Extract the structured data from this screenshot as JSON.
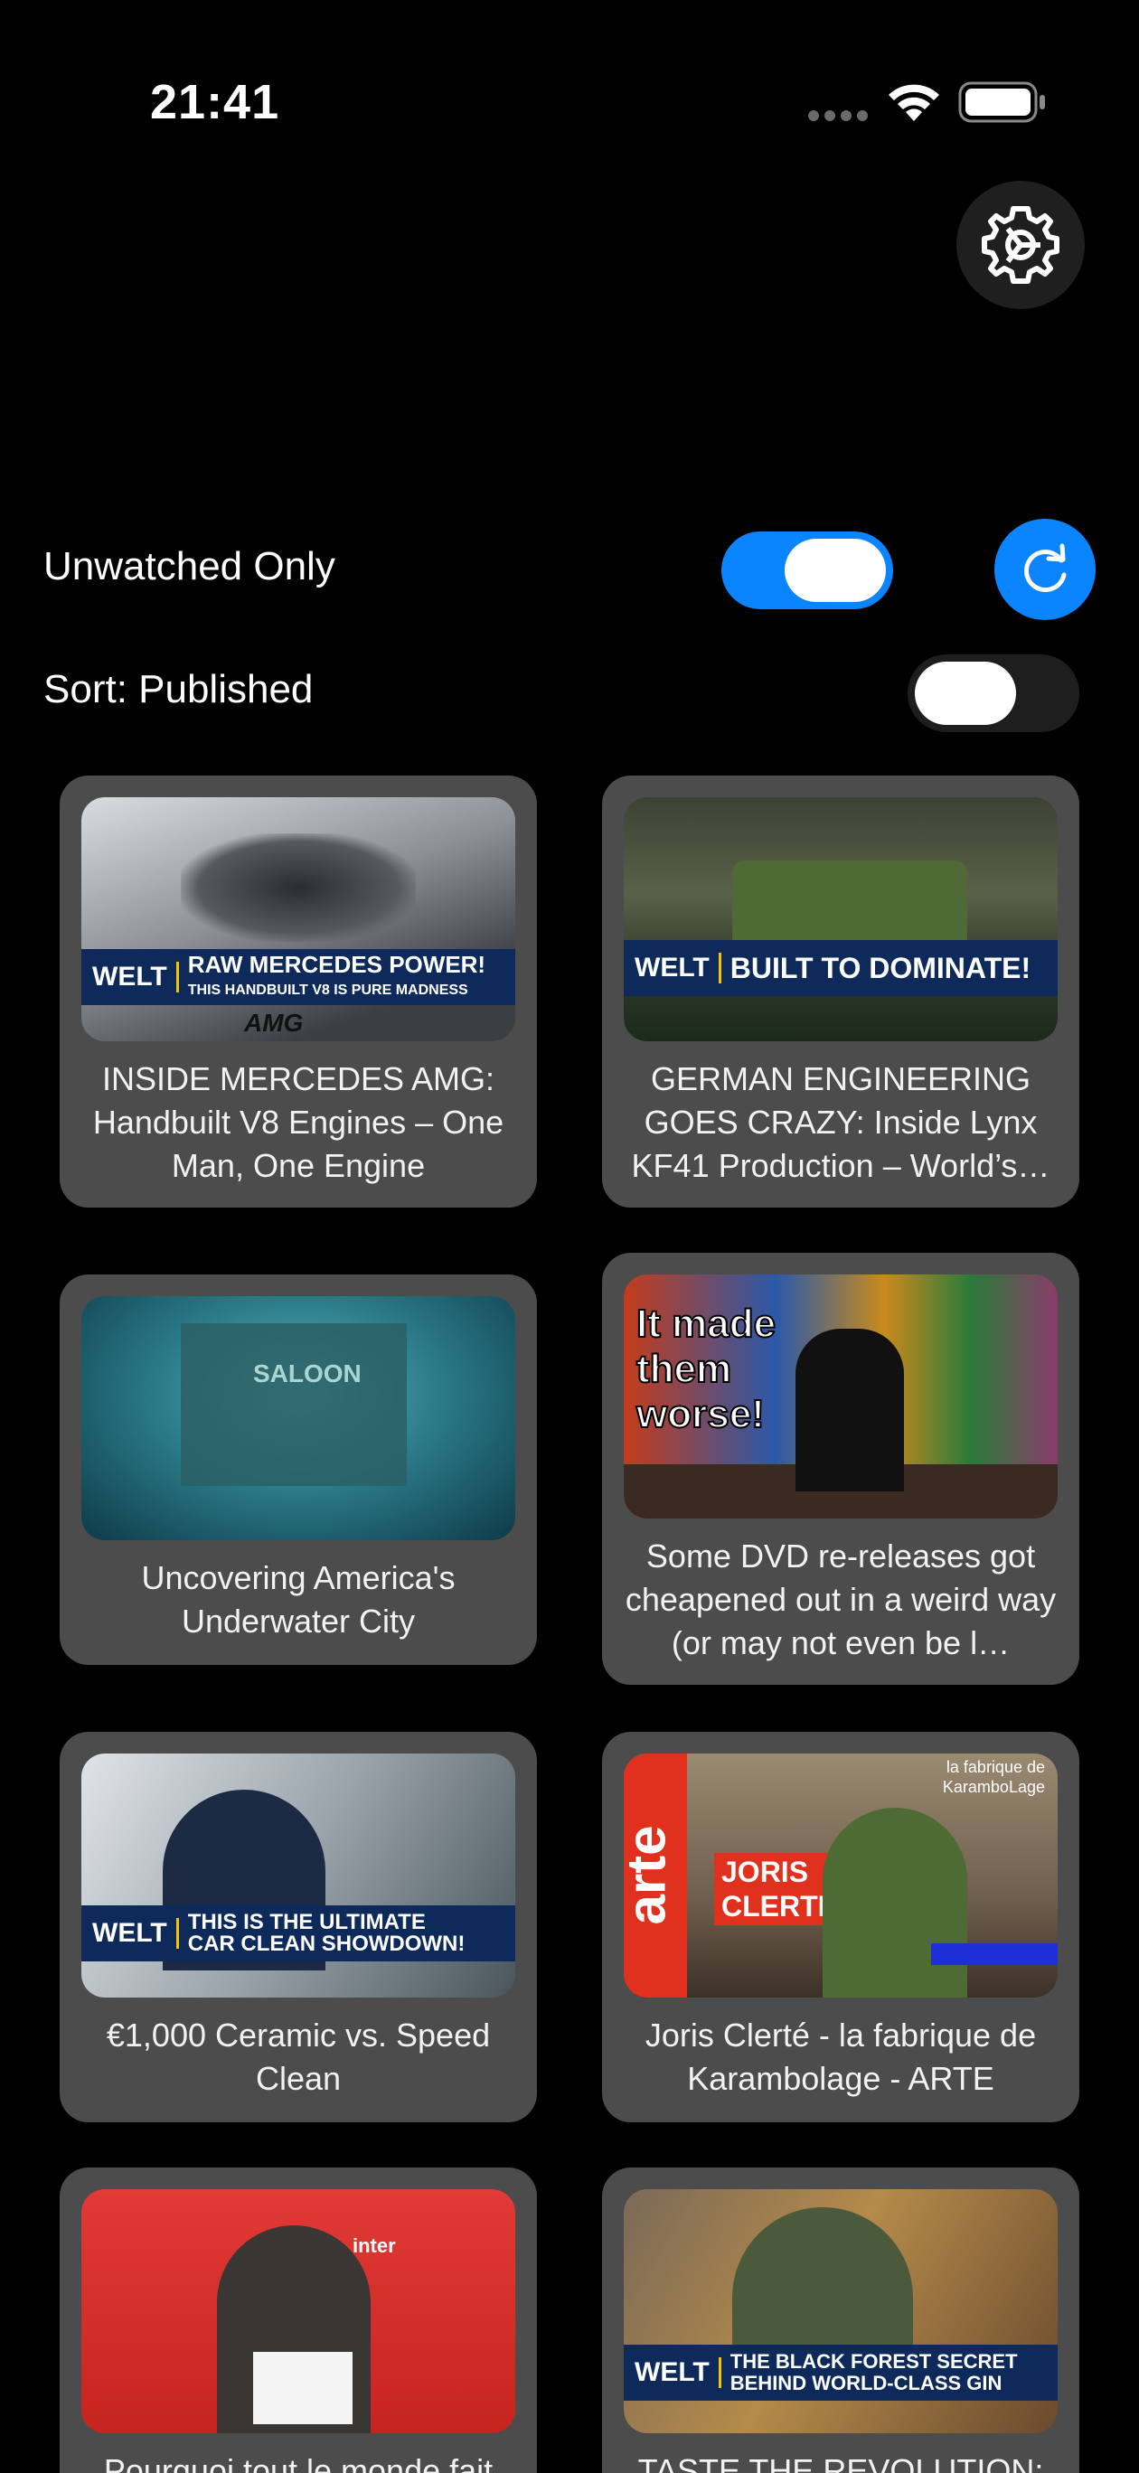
{
  "status_bar": {
    "time": "21:41"
  },
  "controls": {
    "unwatched_label": "Unwatched Only",
    "unwatched_on": true,
    "sort_label": "Sort: Published",
    "sort_on": false
  },
  "colors": {
    "accent": "#0a84ff",
    "card": "#4c4c4c",
    "background": "#000000"
  },
  "icons": {
    "settings": "gear-icon",
    "refresh": "refresh-icon"
  },
  "videos": [
    {
      "title": "INSIDE MERCEDES AMG: Handbuilt V8 Engines – One Man, One Engine",
      "thumb_text": "RAW MERCEDES POWER!",
      "thumb_sub": "THIS HANDBUILT V8 IS PURE MADNESS",
      "thumb_brand": "WELT",
      "thumb_mark": "AMG"
    },
    {
      "title": "GERMAN ENGINEERING GOES CRAZY: Inside Lynx KF41 Production – World’s…",
      "thumb_text": "BUILT TO DOMINATE!",
      "thumb_brand": "WELT"
    },
    {
      "title": "Uncovering America's Underwater City",
      "thumb_text": "SALOON"
    },
    {
      "title": "Some DVD re-releases got cheapened out in a weird way (or may not even be l…",
      "thumb_text": "It made them worse!"
    },
    {
      "title": "€1,000 Ceramic vs. Speed Clean",
      "thumb_text": "THIS IS THE ULTIMATE",
      "thumb_sub": "CAR CLEAN SHOWDOWN!",
      "thumb_brand": "WELT"
    },
    {
      "title": "Joris Clerté - la fabrique de Karambolage - ARTE",
      "thumb_brand": "arte",
      "thumb_text": "JORIS CLERTÉ",
      "thumb_sub": "la fabrique de KaramboLage"
    },
    {
      "title": "Pourquoi tout le monde fait",
      "thumb_text": "inter"
    },
    {
      "title": "TASTE THE REVOLUTION:",
      "thumb_text": "THE BLACK FOREST SECRET",
      "thumb_sub": "BEHIND WORLD-CLASS GIN",
      "thumb_brand": "WELT"
    }
  ]
}
